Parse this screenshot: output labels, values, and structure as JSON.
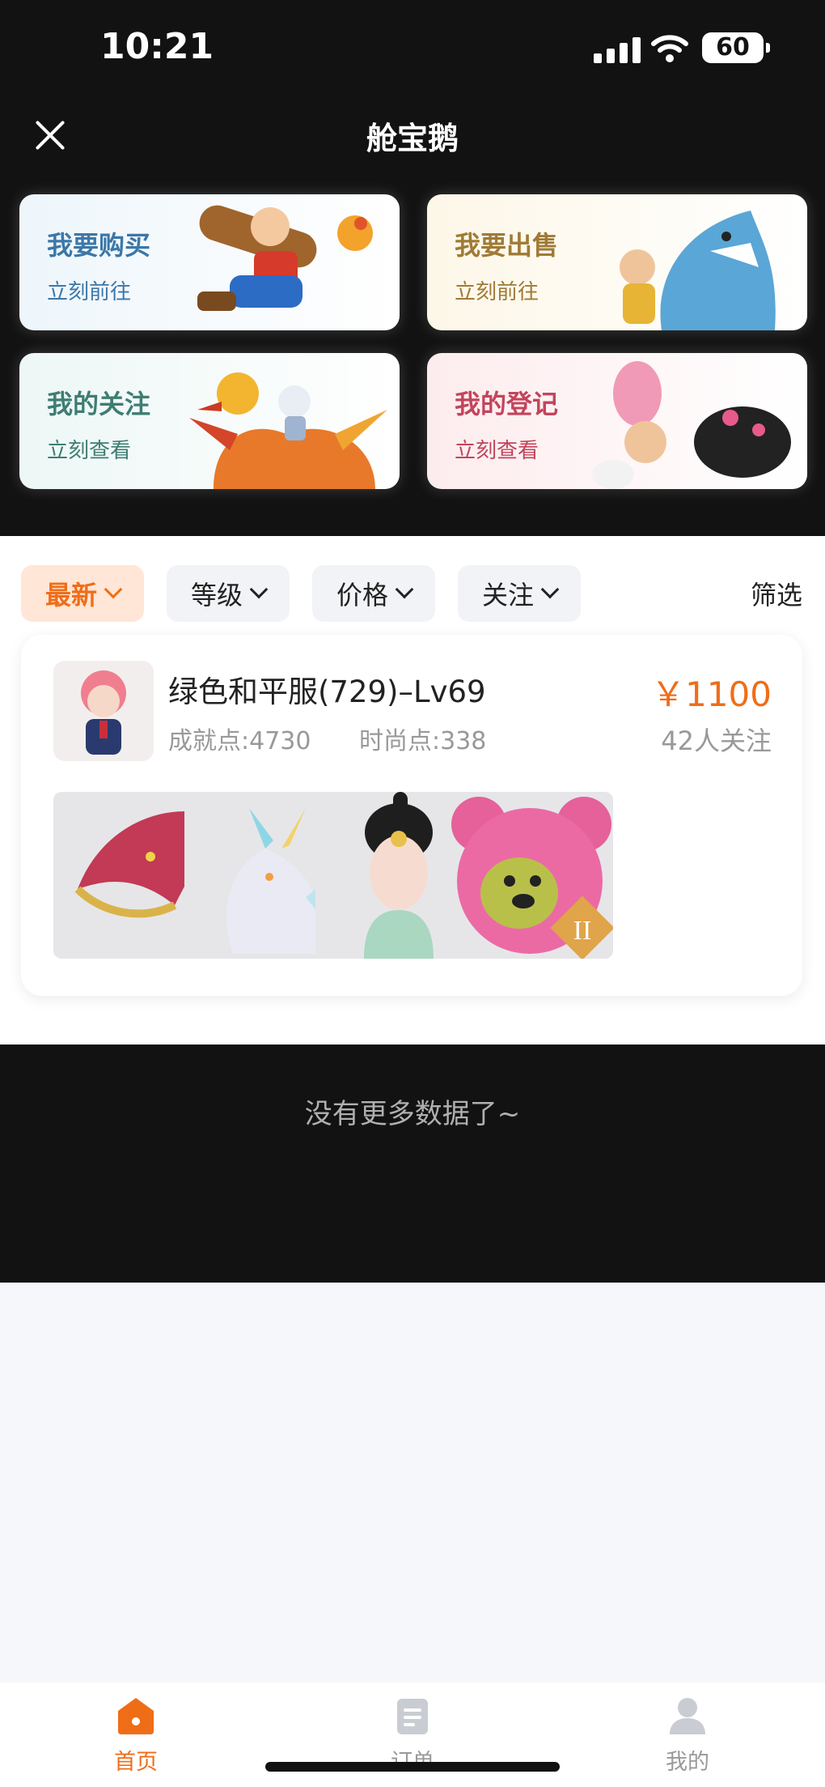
{
  "status_bar": {
    "time": "10:21",
    "battery": "60"
  },
  "header": {
    "title": "舱宝鹅"
  },
  "cards": [
    {
      "title": "我要购买",
      "subtitle": "立刻前往"
    },
    {
      "title": "我要出售",
      "subtitle": "立刻前往"
    },
    {
      "title": "我的关注",
      "subtitle": "立刻查看"
    },
    {
      "title": "我的登记",
      "subtitle": "立刻查看"
    }
  ],
  "filters": {
    "chips": [
      "最新",
      "等级",
      "价格",
      "关注"
    ],
    "filter_label": "筛选",
    "active_index": 0
  },
  "listing": {
    "name": "绿色和平服(729)–Lv69",
    "achievement": "成就点:4730",
    "fashion": "时尚点:338",
    "price": "￥1100",
    "watchers": "42人关注",
    "badge": "II"
  },
  "footer_message": "没有更多数据了~",
  "tabbar": {
    "items": [
      {
        "label": "首页",
        "icon": "home-icon",
        "active": true
      },
      {
        "label": "订单",
        "icon": "clipboard-icon",
        "active": false
      },
      {
        "label": "我的",
        "icon": "user-icon",
        "active": false
      }
    ]
  },
  "colors": {
    "accent": "#f06d18",
    "dark_bg": "#121212",
    "chip_bg": "#f1f3f6"
  }
}
